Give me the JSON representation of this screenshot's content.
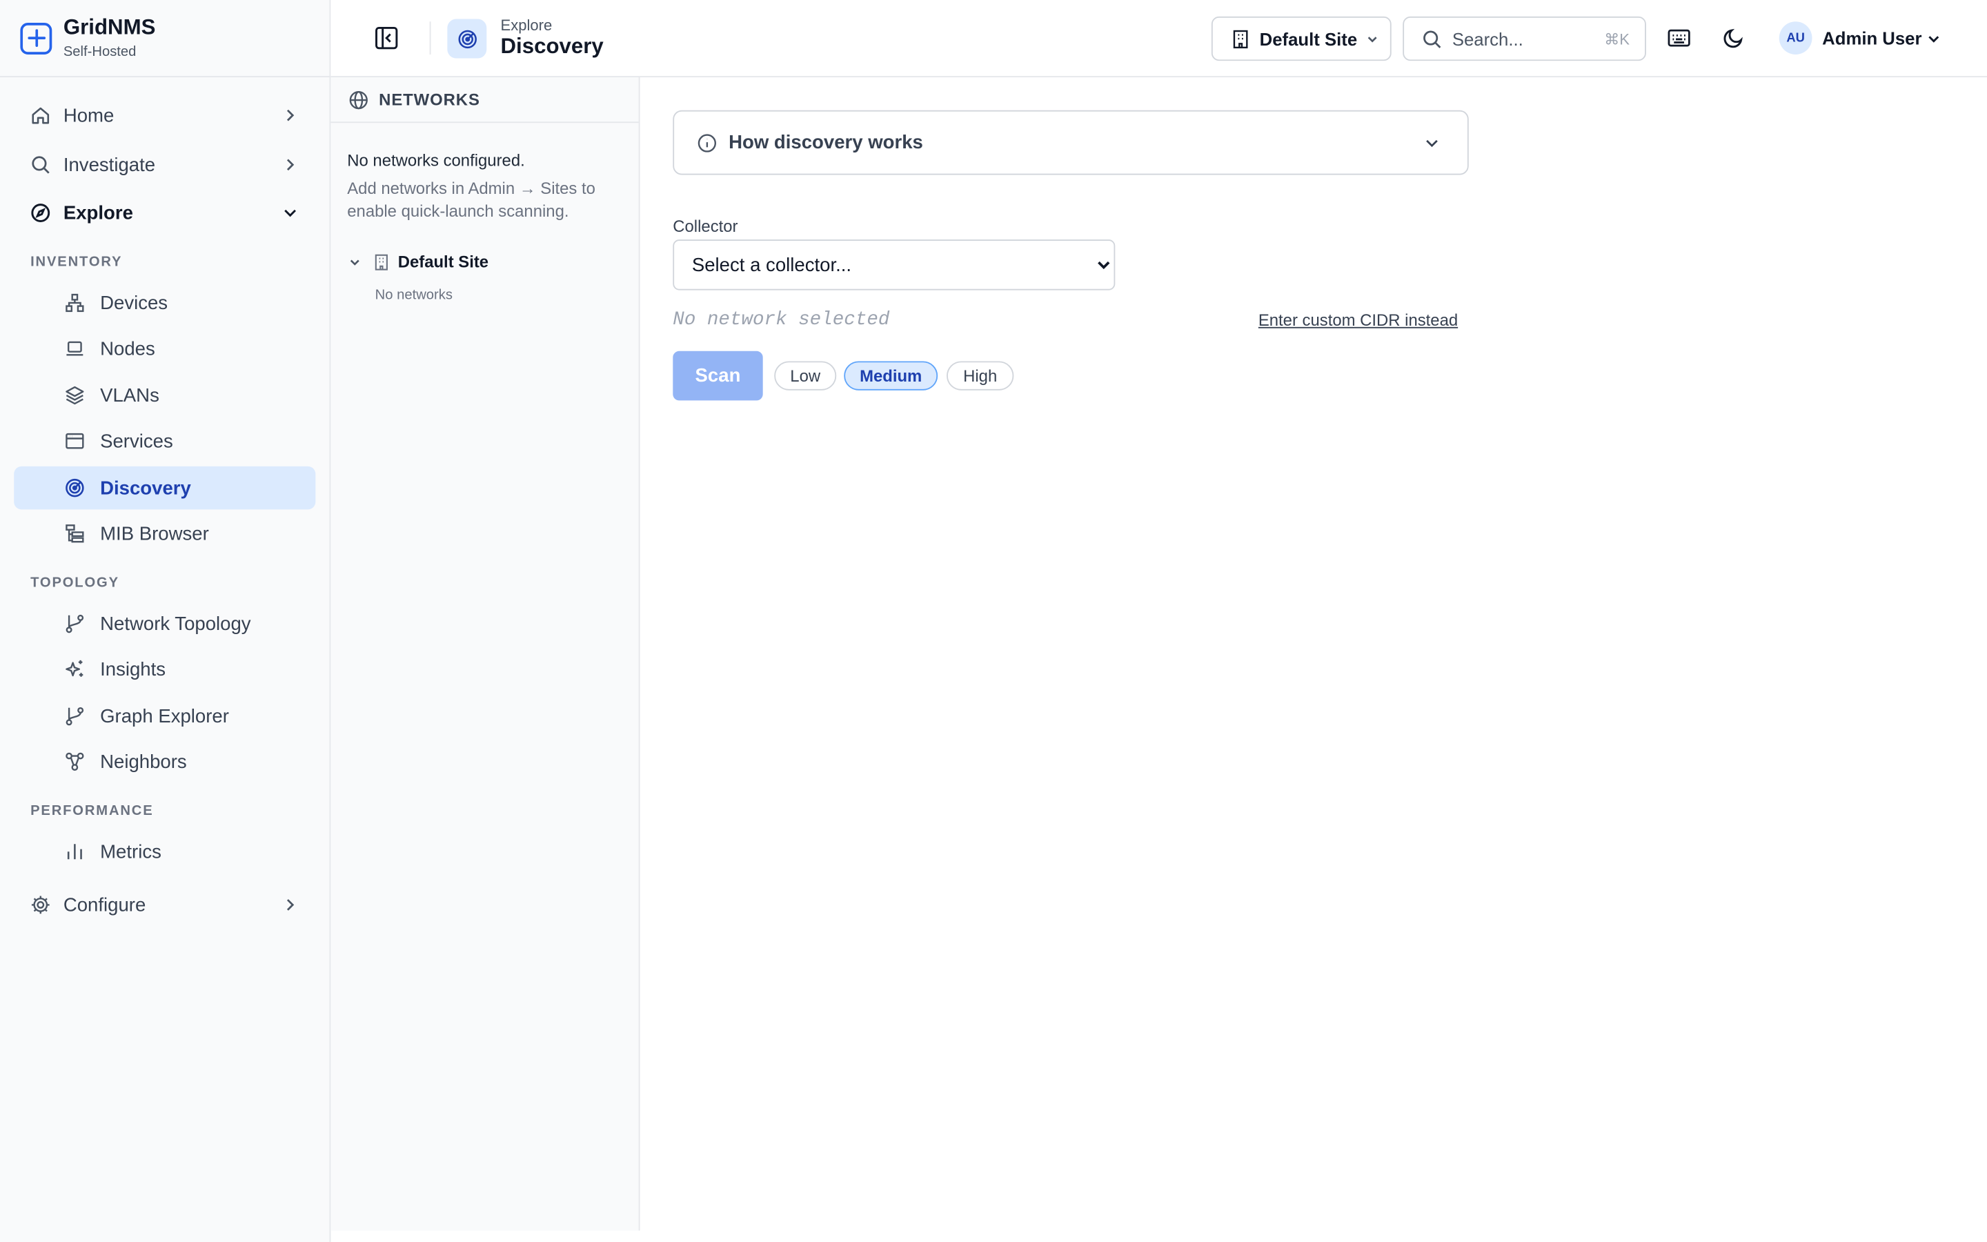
{
  "brand": {
    "name": "GridNMS",
    "subtitle": "Self-Hosted"
  },
  "sidebar": {
    "top": [
      {
        "label": "Home",
        "icon": "home-icon"
      },
      {
        "label": "Investigate",
        "icon": "search-icon"
      },
      {
        "label": "Explore",
        "icon": "compass-icon"
      },
      {
        "label": "Configure",
        "icon": "gear-icon"
      }
    ],
    "sections": [
      {
        "title": "INVENTORY",
        "items": [
          "Devices",
          "Nodes",
          "VLANs",
          "Services",
          "Discovery",
          "MIB Browser"
        ]
      },
      {
        "title": "TOPOLOGY",
        "items": [
          "Network Topology",
          "Insights",
          "Graph Explorer",
          "Neighbors"
        ]
      },
      {
        "title": "PERFORMANCE",
        "items": [
          "Metrics"
        ]
      }
    ],
    "active_item": "Discovery"
  },
  "header": {
    "breadcrumb": "Explore",
    "title": "Discovery",
    "site_selector": "Default Site",
    "search_placeholder": "Search...",
    "search_shortcut": "⌘K",
    "user": {
      "initials": "AU",
      "name": "Admin User"
    }
  },
  "networks": {
    "heading": "NETWORKS",
    "empty_title": "No networks configured.",
    "empty_hint": "Add networks in Admin → Sites to enable quick-launch scanning.",
    "site": {
      "name": "Default Site",
      "status": "No networks"
    }
  },
  "main": {
    "howto_label": "How discovery works",
    "collector_label": "Collector",
    "collector_placeholder": "Select a collector...",
    "no_network_text": "No network selected",
    "custom_cidr_link": "Enter custom CIDR instead",
    "scan_button": "Scan",
    "intensity": {
      "options": [
        "Low",
        "Medium",
        "High"
      ],
      "selected": "Medium"
    }
  },
  "colors": {
    "accent": "#2563eb",
    "active_bg": "#dbeafe",
    "active_text": "#1e40af",
    "scan_disabled": "#93b4f5"
  }
}
